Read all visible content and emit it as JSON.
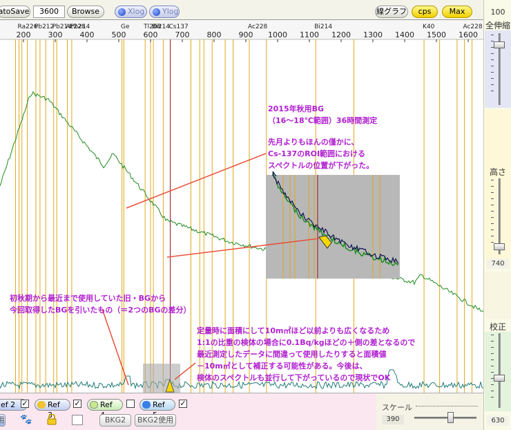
{
  "toolbar": {
    "autosave_label": "atoSave",
    "time_value": "3600",
    "browse_label": "Browse",
    "xlog_label": "Xlog",
    "ylog_label": "Ylog",
    "line_graph_label": "線グラフ",
    "cps_label": "cps",
    "max_label": "Max"
  },
  "right_panel": {
    "top_value": "100",
    "zoom_label": "全伸縮",
    "height_label": "高さ",
    "height_value": "740",
    "calib_label": "校正",
    "calib_value": "630"
  },
  "axis": {
    "ticks": [
      "200",
      "300",
      "400",
      "500",
      "600",
      "700",
      "800",
      "900",
      "1000",
      "1100",
      "1200",
      "1300",
      "1400",
      "1500",
      "1600"
    ],
    "nuclide_labels": [
      {
        "text": "Ra226",
        "kev": 186
      },
      {
        "text": "Pb212",
        "kev": 239
      },
      {
        "text": "Pb214",
        "kev": 295
      },
      {
        "text": "Ac228",
        "kev": 338
      },
      {
        "text": "Pb214",
        "kev": 352
      },
      {
        "text": "Ge",
        "kev": 511
      },
      {
        "text": "Tl208",
        "kev": 583
      },
      {
        "text": "Bi214",
        "kev": 609
      },
      {
        "text": "Cs137",
        "kev": 662
      },
      {
        "text": "Ac228",
        "kev": 911
      },
      {
        "text": "Bi214",
        "kev": 1120
      },
      {
        "text": "K40",
        "kev": 1461
      },
      {
        "text": "Ac228",
        "kev": 1588
      }
    ]
  },
  "annotations": {
    "title_lines": [
      "2015年秋用BG",
      "（16～18℃範囲）36時間測定"
    ],
    "note_lines": [
      "先月よりもほんの僅かに、",
      "Cs-137のROI範囲における",
      "スペクトルの位置が下がった。"
    ],
    "diff_lines": [
      "初秋期から最近まで使用していた旧・BGから",
      "今回取得したBGを引いたもの（＝2つのBGの差分）"
    ],
    "quant_lines": [
      "定量時に面積にして10m㎡ほど以前よりも広くなるため",
      "1:1の比重の検体の場合に0.1Bq/kgほどの＋側の差となるので",
      "最近測定したデータに間違って使用したりすると面積値",
      "－10m㎡として補正する可能性がある。今後は、",
      "検体のスペクトルも並行して下がっているので現状でOK"
    ]
  },
  "bottom": {
    "ref2_label": "ef 2",
    "ref3_label": "Ref 3",
    "ref4_label": "Ref 4",
    "ref5_label": "Ref 5",
    "bkg2_label": "BKG2",
    "bkg2_use_label": "BKG2使用",
    "partial_label": "用",
    "scale_label": "スケール",
    "scale_value": "390"
  },
  "colors": {
    "spectrum": "#1e8c1e",
    "difference": "#1e7a78",
    "inset_black": "#101050",
    "roi_lines": "#e0a81c",
    "cs137_line": "#9c1010",
    "annotation": "#b01fd0",
    "arrow": "#e8503a"
  },
  "icons": [
    "paw-icon",
    "lock-icon",
    "memo-icon"
  ]
}
